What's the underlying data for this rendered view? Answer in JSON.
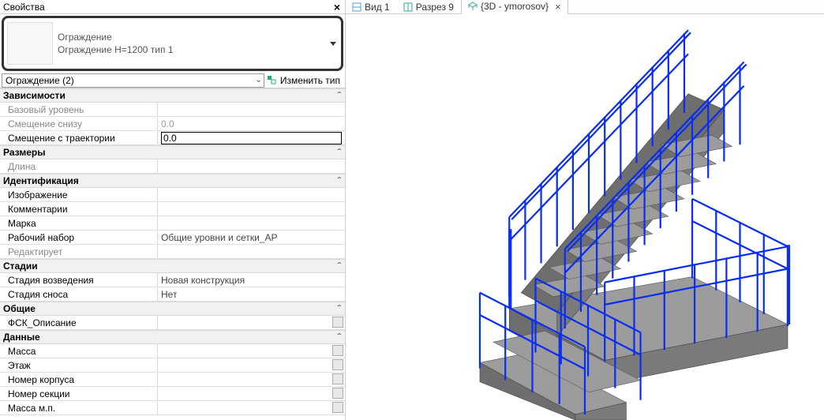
{
  "panel": {
    "title": "Свойства",
    "type_selector": {
      "line1": "Ограждение",
      "line2": "Ограждение H=1200 тип 1"
    },
    "filter": "Ограждение (2)",
    "edit_type": "Изменить тип"
  },
  "sections": {
    "deps": {
      "title": "Зависимости",
      "base_level": "Базовый уровень",
      "bottom_offset_label": "Смещение снизу",
      "bottom_offset_value": "0.0",
      "trajectory_offset_label": "Смещение с траектории",
      "trajectory_offset_value": "0.0"
    },
    "sizes": {
      "title": "Размеры",
      "length": "Длина"
    },
    "ident": {
      "title": "Идентификация",
      "image": "Изображение",
      "comments": "Комментарии",
      "mark": "Марка",
      "workset_label": "Рабочий набор",
      "workset_value": "Общие уровни и сетки_АР",
      "edits": "Редактирует"
    },
    "stages": {
      "title": "Стадии",
      "created_label": "Стадия возведения",
      "created_value": "Новая конструкция",
      "demolished_label": "Стадия сноса",
      "demolished_value": "Нет"
    },
    "common": {
      "title": "Общие",
      "fsk": "ФСК_Описание"
    },
    "data": {
      "title": "Данные",
      "mass": "Масса",
      "floor": "Этаж",
      "block": "Номер корпуса",
      "section": "Номер секции",
      "mass_mn": "Масса м.п."
    }
  },
  "tabs": {
    "view1": "Вид 1",
    "section9": "Разрез 9",
    "active": "{3D - ymorosov}"
  }
}
